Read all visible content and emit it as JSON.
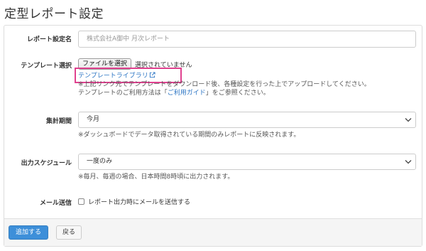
{
  "page": {
    "title": "定型レポート設定"
  },
  "form": {
    "report_name": {
      "label": "レポート設定名",
      "placeholder": "株式会社A御中 月次レポート"
    },
    "template": {
      "label": "テンプレート選択",
      "file_button": "ファイルを選択",
      "file_status": "選択されていません",
      "library_link": "テンプレートライブラリ",
      "help_line1": "※上記リンク先でテンプレートをダウンロード後、各種設定を行った上でアップロードしてください。",
      "help_line2_prefix": "テンプレートのご利用方法は「",
      "help_line2_link": "ご利用ガイド",
      "help_line2_suffix": "」をご参照ください。"
    },
    "period": {
      "label": "集計期間",
      "selected": "今月",
      "help": "※ダッシュボードでデータ取得されている期間のみレポートに反映されます。"
    },
    "schedule": {
      "label": "出力スケジュール",
      "selected": "一度のみ",
      "help": "※毎月、毎週の場合、日本時間8時頃に出力されます。"
    },
    "email": {
      "label": "メール送信",
      "checkbox_label": "レポート出力時にメールを送信する",
      "checked": false
    }
  },
  "footer": {
    "submit_label": "追加する",
    "back_label": "戻る"
  },
  "colors": {
    "primary": "#3d8fd9",
    "link": "#2a74c4",
    "highlight": "#e0418f"
  }
}
